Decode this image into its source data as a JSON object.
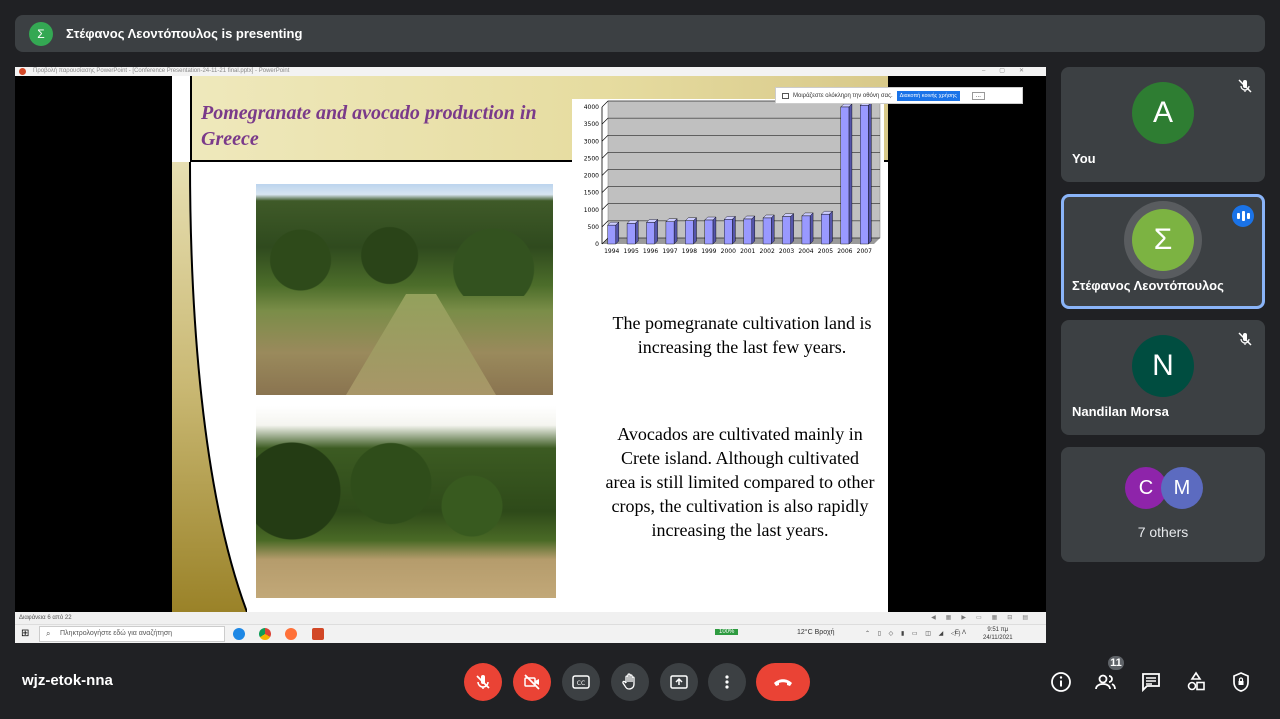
{
  "presenting_bar": {
    "avatar_letter": "Σ",
    "text": "Στέφανος Λεοντόπουλος is presenting"
  },
  "shared_screen": {
    "window_title": "Προβολή παρουσίασης PowerPoint - [Conference Presentation-24-11-21 final.pptx] - PowerPoint",
    "share_notice": {
      "text": "Μοιράζεστε ολόκληρη την οθόνη σας.",
      "button": "Διακοπή κοινής χρήσης",
      "more": "..."
    },
    "slide": {
      "title": "Pomegranate and avocado production in Greece",
      "paragraph1": "The pomegranate cultivation land is increasing the last few years.",
      "paragraph2": "Avocados are cultivated mainly in Crete island. Although cultivated area is still limited compared to other crops, the cultivation is also rapidly increasing the last years."
    },
    "status_bar": {
      "slide_counter": "Διαφάνεια 6 από 22"
    },
    "taskbar": {
      "search_placeholder": "Πληκτρολογήστε εδώ για αναζήτηση",
      "zoom": "100%",
      "weather": "12°C Βροχή",
      "lang": "ΕΛ",
      "time": "9:51 πμ",
      "date": "24/11/2021"
    }
  },
  "chart_data": {
    "type": "bar",
    "categories": [
      "1994",
      "1995",
      "1996",
      "1997",
      "1998",
      "1999",
      "2000",
      "2001",
      "2002",
      "2003",
      "2004",
      "2005",
      "2006",
      "2007"
    ],
    "values": [
      550,
      600,
      630,
      650,
      680,
      700,
      720,
      730,
      760,
      800,
      820,
      870,
      4000,
      4050
    ],
    "ylim": [
      0,
      4000
    ],
    "yticks": [
      "0",
      "500",
      "1000",
      "1500",
      "2000",
      "2500",
      "3000",
      "3500",
      "4000"
    ],
    "grid": true,
    "bar_color": "#9999ff"
  },
  "participants": [
    {
      "name": "You",
      "letter": "A",
      "color": "#2e7d32",
      "muted": true
    },
    {
      "name": "Στέφανος Λεοντόπουλος",
      "letter": "Σ",
      "color": "#34a853",
      "speaking": true
    },
    {
      "name": "Nandilan Morsa",
      "letter": "N",
      "color": "#004d40",
      "muted": true
    }
  ],
  "others": {
    "letters": [
      "C",
      "M"
    ],
    "colors": [
      "#8e24aa",
      "#5c6bc0"
    ],
    "label": "7 others"
  },
  "bottom_bar": {
    "meeting_code": "wjz-etok-nna",
    "people_count": "11"
  },
  "colors": {
    "background": "#202124",
    "tile": "#3c4043",
    "danger": "#ea4335",
    "accent": "#8ab4f8"
  }
}
